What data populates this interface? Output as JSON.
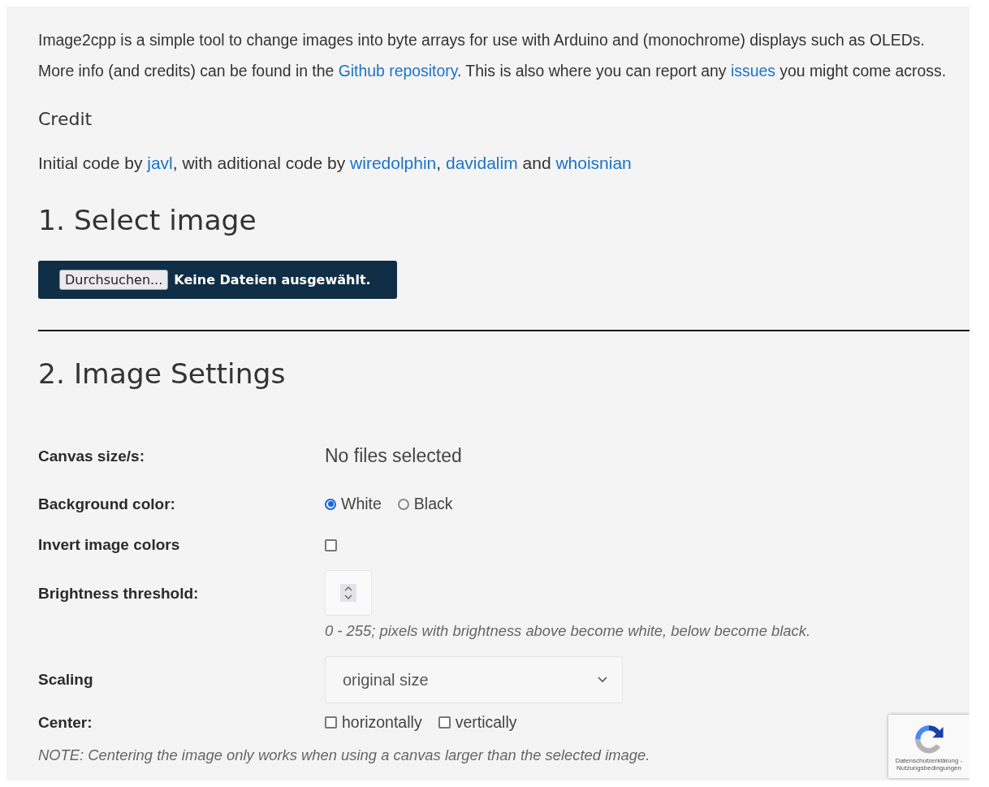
{
  "intro": [
    [
      {
        "kind": "text",
        "text": "Image2cpp is a simple tool to change images into byte arrays for use with Arduino and (monochrome) displays such as OLEDs."
      }
    ],
    [
      {
        "kind": "text",
        "text": "More info (and credits) can be found in the "
      },
      {
        "kind": "link",
        "text": "Github repository"
      },
      {
        "kind": "text",
        "text": ". This is also where you can report any "
      },
      {
        "kind": "link",
        "text": "issues"
      },
      {
        "kind": "text",
        "text": " you might come across."
      }
    ]
  ],
  "credit": {
    "title": "Credit",
    "line": [
      {
        "kind": "text",
        "text": "Initial code by "
      },
      {
        "kind": "link",
        "text": "javl"
      },
      {
        "kind": "text",
        "text": ", with aditional code by "
      },
      {
        "kind": "link",
        "text": "wiredolphin"
      },
      {
        "kind": "text",
        "text": ", "
      },
      {
        "kind": "link",
        "text": "davidalim"
      },
      {
        "kind": "text",
        "text": " and "
      },
      {
        "kind": "link",
        "text": "whoisnian"
      }
    ]
  },
  "select_image": {
    "title": "1. Select image",
    "browse_button": "Durchsuchen...",
    "file_status": "Keine Dateien ausgewählt."
  },
  "image_settings": {
    "title": "2. Image Settings",
    "rows": [
      {
        "kind": "text",
        "label": "Canvas size/s:",
        "value": "No files selected"
      },
      {
        "kind": "radio",
        "label": "Background color:",
        "options": [
          {
            "label": "White",
            "selected": true
          },
          {
            "label": "Black",
            "selected": false
          }
        ]
      },
      {
        "kind": "checkbox",
        "label": "Invert image colors",
        "checked": false
      },
      {
        "kind": "number",
        "label": "Brightness threshold:",
        "hint": "0 - 255; pixels with brightness above become white, below become black."
      },
      {
        "kind": "select",
        "label": "Scaling",
        "value": "original size"
      },
      {
        "kind": "checks",
        "label": "Center:",
        "options": [
          {
            "label": "horizontally",
            "checked": false
          },
          {
            "label": "vertically",
            "checked": false
          }
        ]
      }
    ],
    "note": "NOTE: Centering the image only works when using a canvas larger than the selected image."
  },
  "recaptcha": {
    "line_1": "Datenschutzerklärung -",
    "line_2": "Nutzungsbedingungen"
  }
}
